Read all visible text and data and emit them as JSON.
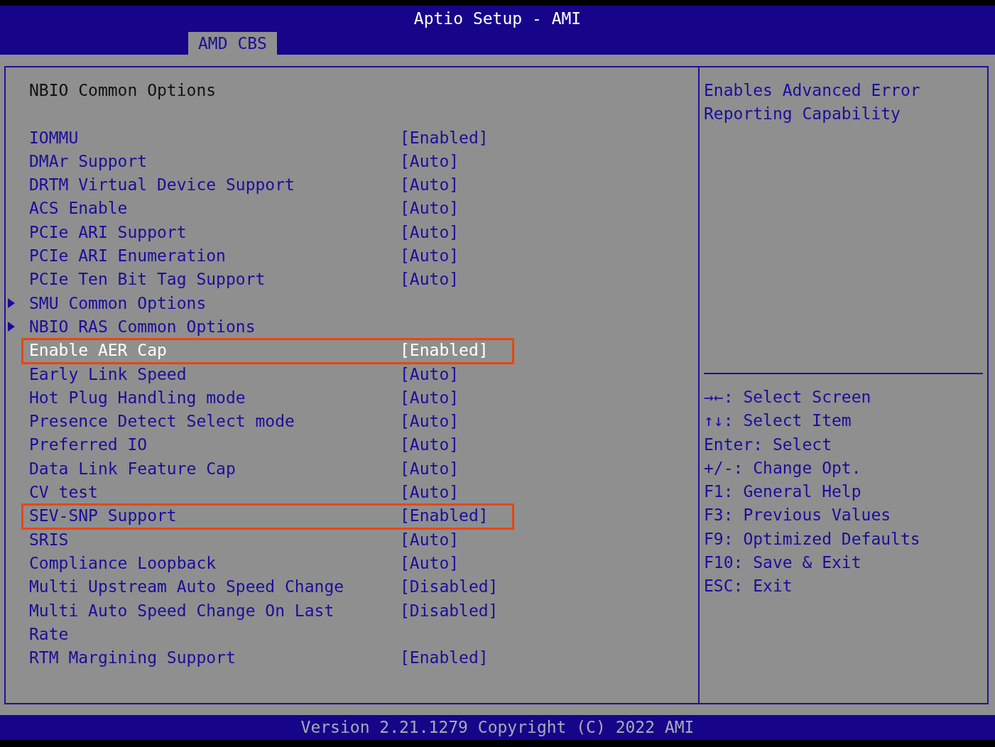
{
  "window": {
    "title": "Aptio Setup - AMI"
  },
  "tabs": [
    {
      "label": "AMD CBS",
      "selected": true
    }
  ],
  "page": {
    "title": "NBIO Common Options",
    "items": [
      {
        "kind": "setting",
        "label": "IOMMU",
        "value": "[Enabled]",
        "selected": false,
        "highlighted": false
      },
      {
        "kind": "setting",
        "label": "DMAr Support",
        "value": "[Auto]",
        "selected": false,
        "highlighted": false
      },
      {
        "kind": "setting",
        "label": "DRTM Virtual Device Support",
        "value": "[Auto]",
        "selected": false,
        "highlighted": false
      },
      {
        "kind": "setting",
        "label": "ACS Enable",
        "value": "[Auto]",
        "selected": false,
        "highlighted": false
      },
      {
        "kind": "setting",
        "label": "PCIe ARI Support",
        "value": "[Auto]",
        "selected": false,
        "highlighted": false
      },
      {
        "kind": "setting",
        "label": "PCIe ARI Enumeration",
        "value": "[Auto]",
        "selected": false,
        "highlighted": false
      },
      {
        "kind": "setting",
        "label": "PCIe Ten Bit Tag Support",
        "value": "[Auto]",
        "selected": false,
        "highlighted": false
      },
      {
        "kind": "submenu",
        "label": "SMU Common Options",
        "selected": false,
        "highlighted": false
      },
      {
        "kind": "submenu",
        "label": "NBIO RAS Common Options",
        "selected": false,
        "highlighted": false
      },
      {
        "kind": "setting",
        "label": "Enable AER Cap",
        "value": "[Enabled]",
        "selected": true,
        "highlighted": true
      },
      {
        "kind": "setting",
        "label": "Early Link Speed",
        "value": "[Auto]",
        "selected": false,
        "highlighted": false
      },
      {
        "kind": "setting",
        "label": "Hot Plug Handling mode",
        "value": "[Auto]",
        "selected": false,
        "highlighted": false
      },
      {
        "kind": "setting",
        "label": "Presence Detect Select mode",
        "value": "[Auto]",
        "selected": false,
        "highlighted": false
      },
      {
        "kind": "setting",
        "label": "Preferred IO",
        "value": "[Auto]",
        "selected": false,
        "highlighted": false
      },
      {
        "kind": "setting",
        "label": "Data Link Feature Cap",
        "value": "[Auto]",
        "selected": false,
        "highlighted": false
      },
      {
        "kind": "setting",
        "label": "CV test",
        "value": "[Auto]",
        "selected": false,
        "highlighted": false
      },
      {
        "kind": "setting",
        "label": "SEV-SNP Support",
        "value": "[Enabled]",
        "selected": false,
        "highlighted": true
      },
      {
        "kind": "setting",
        "label": "SRIS",
        "value": "[Auto]",
        "selected": false,
        "highlighted": false
      },
      {
        "kind": "setting",
        "label": "Compliance Loopback",
        "value": "[Auto]",
        "selected": false,
        "highlighted": false
      },
      {
        "kind": "setting",
        "label": "Multi Upstream Auto Speed Change",
        "value": "[Disabled]",
        "selected": false,
        "highlighted": false
      },
      {
        "kind": "setting",
        "label": "Multi Auto Speed Change On Last Rate",
        "value": "[Disabled]",
        "selected": false,
        "highlighted": false
      },
      {
        "kind": "setting",
        "label": "RTM Margining Support",
        "value": "[Enabled]",
        "selected": false,
        "highlighted": false
      }
    ]
  },
  "help": {
    "text": "Enables Advanced Error Reporting Capability"
  },
  "keys": [
    "→←: Select Screen",
    "↑↓: Select Item",
    "Enter: Select",
    "+/-: Change Opt.",
    "F1: General Help",
    "F3: Previous Values",
    "F9: Optimized Defaults",
    "F10: Save & Exit",
    "ESC: Exit"
  ],
  "footer": "Version 2.21.1279 Copyright (C) 2022 AMI"
}
